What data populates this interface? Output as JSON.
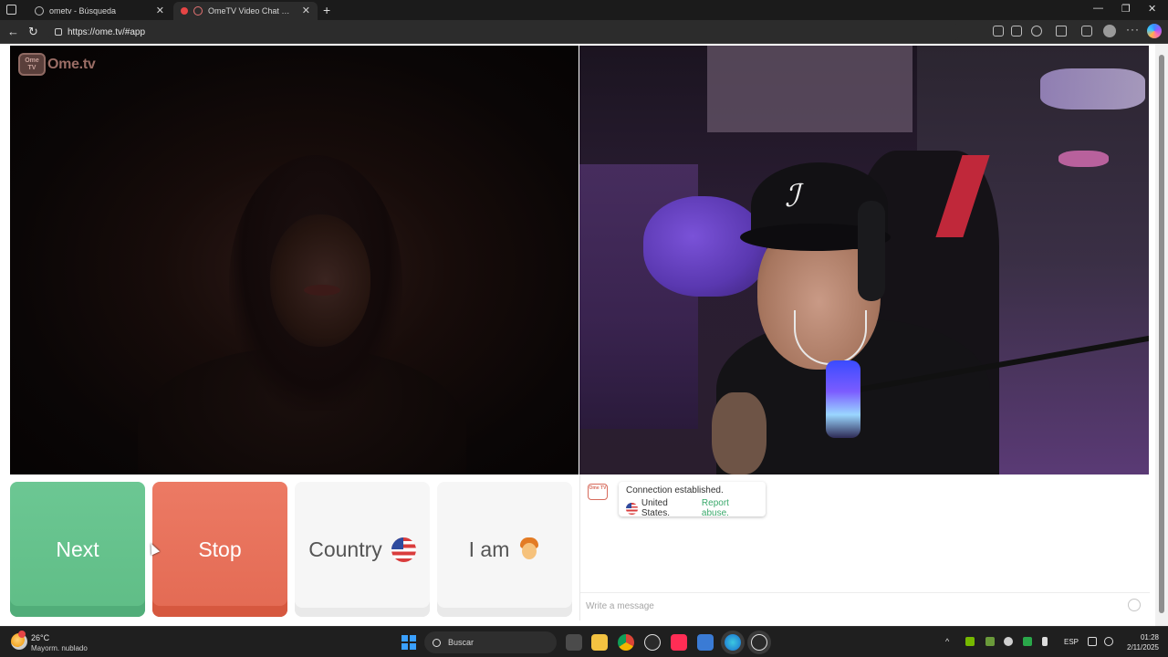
{
  "browser": {
    "tabs": [
      {
        "title": "ometv - Búsqueda",
        "active": false
      },
      {
        "title": "OmeTV Video Chat — Omegle",
        "active": true
      }
    ],
    "url": "https://ome.tv/#app"
  },
  "logo": {
    "badge": "Ome TV",
    "text": "Ome.tv"
  },
  "controls": {
    "next_label": "Next",
    "stop_label": "Stop",
    "country_label": "Country",
    "iam_label": "I am"
  },
  "chat": {
    "avatar": "Ome TV",
    "message_line1": "Connection established.",
    "message_country": "United States.",
    "message_report": "Report abuse.",
    "input_placeholder": "Write a message"
  },
  "taskbar": {
    "temperature": "26°C",
    "weather": "Mayorm. nublado",
    "search_label": "Buscar",
    "language": "ESP",
    "time": "01:28",
    "date": "2/11/2025"
  },
  "colors": {
    "next": "#62bf89",
    "stop": "#e66d56",
    "link": "#3aa96b"
  }
}
